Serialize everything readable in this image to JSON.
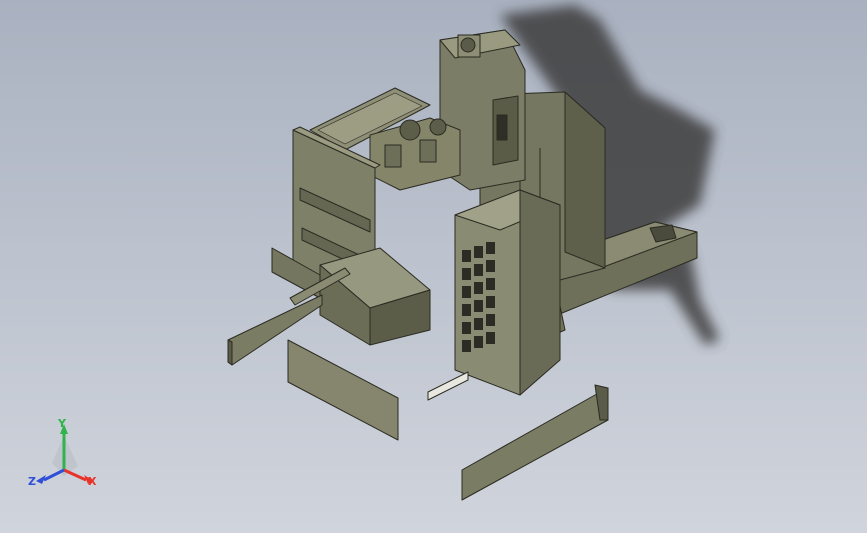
{
  "triad": {
    "x_label": "X",
    "y_label": "Y",
    "z_label": "Z",
    "x_color": "#e8332a",
    "y_color": "#2fb34a",
    "z_color": "#2f4fd8"
  },
  "colors": {
    "background_top": "#a9b1c0",
    "background_bottom": "#d0d4dc",
    "part_body": "#7b7c64",
    "part_edge": "#2b2b22",
    "part_shadow": "#3c3d3e"
  }
}
